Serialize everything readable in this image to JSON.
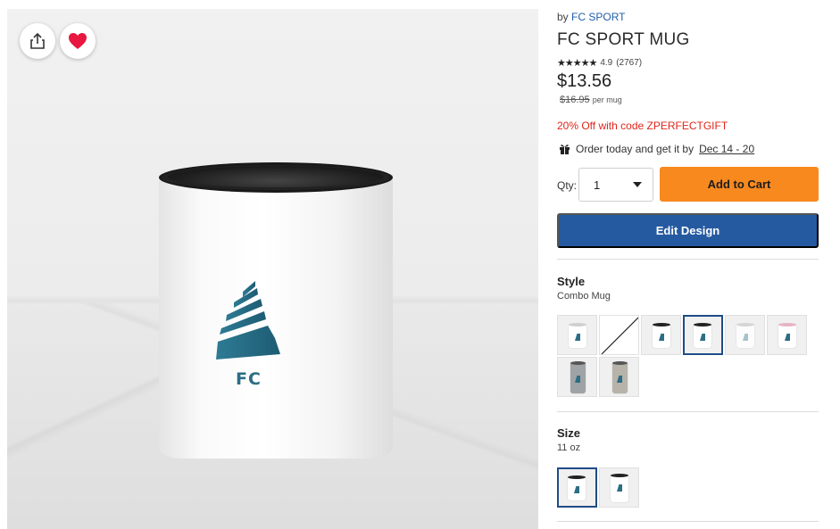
{
  "product_image": {
    "logo_text": "FC",
    "share_icon": "share-icon",
    "favorite_icon": "heart-icon",
    "favorite_color": "#e8173f"
  },
  "product": {
    "by_label": "by",
    "brand": "FC SPORT",
    "title": "FC SPORT MUG",
    "stars": "★★★★★",
    "rating": "4.9",
    "review_count": "(2767)",
    "price": "$13.56",
    "original_price": "$16.95",
    "per_unit": "per mug",
    "promo": "20% Off with code ZPERFECTGIFT",
    "delivery_text": "Order today and get it by",
    "delivery_date": "Dec 14 - 20"
  },
  "purchase": {
    "qty_label": "Qty:",
    "qty_value": "1",
    "add_to_cart": "Add to Cart",
    "edit_design": "Edit Design"
  },
  "style": {
    "label": "Style",
    "value": "Combo Mug",
    "options_count": 8,
    "selected_index": 3
  },
  "size": {
    "label": "Size",
    "value": "11 oz",
    "options_count": 2,
    "selected_index": 0
  },
  "colors": {
    "add_to_cart": "#f7891f",
    "edit_design": "#255aa0",
    "promo": "#e0251b",
    "brand_link": "#1f5fa8"
  }
}
